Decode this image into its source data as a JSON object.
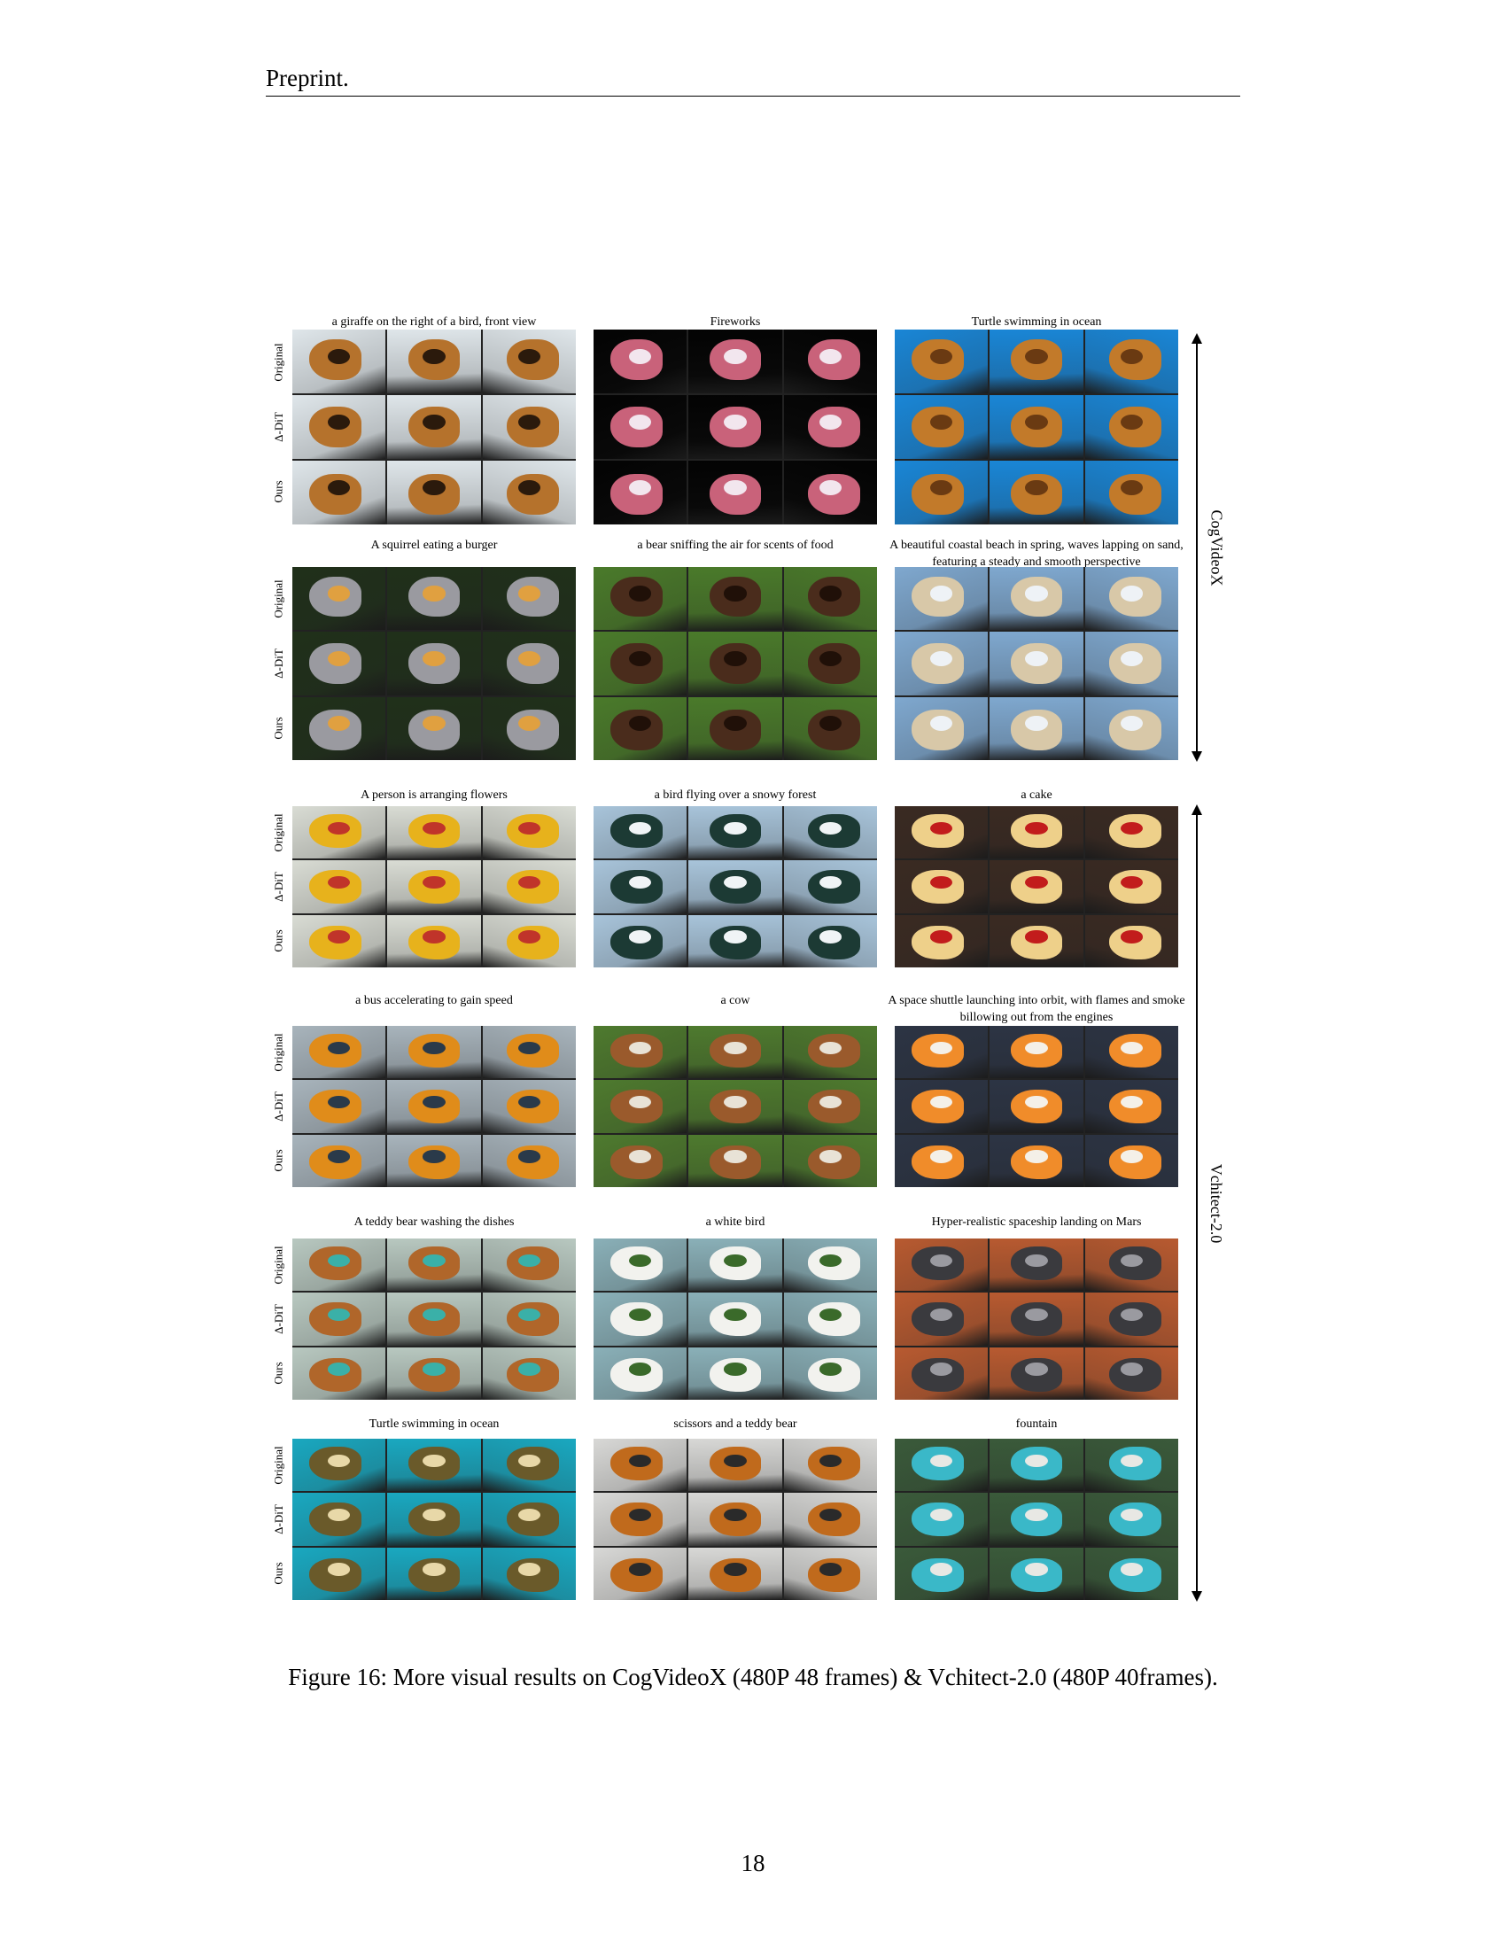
{
  "header": {
    "running_title": "Preprint."
  },
  "row_labels": [
    "Original",
    "Δ-DiT",
    "Ours"
  ],
  "groups": [
    {
      "model": "CogVideoX"
    },
    {
      "model": "Vchitect-2.0"
    }
  ],
  "panels": [
    {
      "caption": "a giraffe on the right of a bird, front view",
      "bg": "#dfe6ea",
      "subject": "#b5722c",
      "detail": "#2b1a0c"
    },
    {
      "caption": "Fireworks",
      "bg": "#030303",
      "subject": "#c9627a",
      "detail": "#f2e6ee"
    },
    {
      "caption": "Turtle swimming in ocean",
      "bg": "#1a86d6",
      "subject": "#c27a2a",
      "detail": "#6a3a12"
    },
    {
      "caption": "A squirrel eating a burger",
      "bg": "#20301a",
      "subject": "#9a9aa0",
      "detail": "#e0a040"
    },
    {
      "caption": "a bear sniffing the air for scents of food",
      "bg": "#4a7a2a",
      "subject": "#4a2c1c",
      "detail": "#201008"
    },
    {
      "caption": "A beautiful coastal beach in spring, waves lapping on sand, featuring a steady and smooth perspective",
      "bg": "#7fa8cf",
      "subject": "#d8c8a8",
      "detail": "#eef2f6"
    },
    {
      "caption": "A person is arranging flowers",
      "bg": "#d9dcd4",
      "subject": "#e7b21c",
      "detail": "#c0342a"
    },
    {
      "caption": "a bird flying over a snowy forest",
      "bg": "#a8c4da",
      "subject": "#1c3a34",
      "detail": "#f0f4f6"
    },
    {
      "caption": "a cake",
      "bg": "#3a2a22",
      "subject": "#eed08a",
      "detail": "#c21c1c"
    },
    {
      "caption": "a bus accelerating to gain speed",
      "bg": "#a8b4bc",
      "subject": "#e08c1a",
      "detail": "#2a3a4a"
    },
    {
      "caption": "a cow",
      "bg": "#4e7a2e",
      "subject": "#9a5a2c",
      "detail": "#e8e2d6"
    },
    {
      "caption": "A space shuttle launching into orbit, with flames and smoke billowing out from the engines",
      "bg": "#2c3444",
      "subject": "#f08c2a",
      "detail": "#f4f0e8"
    },
    {
      "caption": "A teddy bear washing the dishes",
      "bg": "#b8c8c0",
      "subject": "#b0662a",
      "detail": "#3ab0a8"
    },
    {
      "caption": "a white bird",
      "bg": "#8ab0b8",
      "subject": "#f2f2ee",
      "detail": "#3a6a2a"
    },
    {
      "caption": "Hyper-realistic spaceship landing on Mars",
      "bg": "#b85a30",
      "subject": "#3a3a3e",
      "detail": "#9a9aa0"
    },
    {
      "caption": "Turtle swimming in ocean",
      "bg": "#1aa8c0",
      "subject": "#6a5a2a",
      "detail": "#e8d8a8"
    },
    {
      "caption": "scissors and a teddy bear",
      "bg": "#d8d8d6",
      "subject": "#c06a1c",
      "detail": "#2a2a2a"
    },
    {
      "caption": "fountain",
      "bg": "#3a5a3a",
      "subject": "#3ab8c8",
      "detail": "#e8e8e4"
    }
  ],
  "figure_caption": "Figure 16: More visual results on CogVideoX (480P 48 frames) & Vchitect-2.0 (480P 40frames).",
  "page_number": "18"
}
